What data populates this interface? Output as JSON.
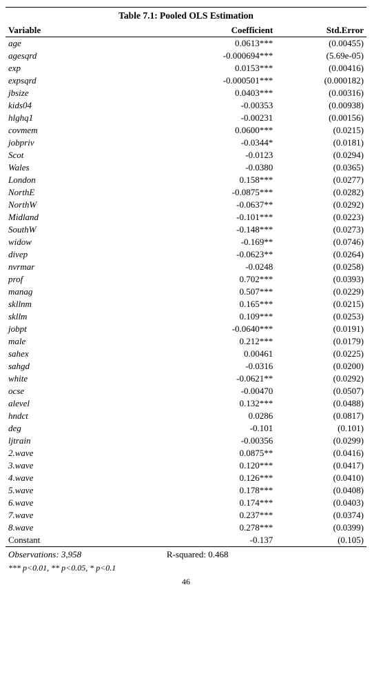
{
  "title": "Table 7.1: Pooled OLS Estimation",
  "headers": [
    "Variable",
    "Coefficient",
    "Std.Error"
  ],
  "rows": [
    [
      "age",
      "0.0613***",
      "(0.00455)"
    ],
    [
      "agesqrd",
      "-0.000694***",
      "(5.69e-05)"
    ],
    [
      "exp",
      "0.0153***",
      "(0.00416)"
    ],
    [
      "expsqrd",
      "-0.000501***",
      "(0.000182)"
    ],
    [
      "jbsize",
      "0.0403***",
      "(0.00316)"
    ],
    [
      "kids04",
      "-0.00353",
      "(0.00938)"
    ],
    [
      "hlghq1",
      "-0.00231",
      "(0.00156)"
    ],
    [
      "covmem",
      "0.0600***",
      "(0.0215)"
    ],
    [
      "jobpriv",
      "-0.0344*",
      "(0.0181)"
    ],
    [
      "Scot",
      "-0.0123",
      "(0.0294)"
    ],
    [
      "Wales",
      "-0.0380",
      "(0.0365)"
    ],
    [
      "London",
      "0.158***",
      "(0.0277)"
    ],
    [
      "NorthE",
      "-0.0875***",
      "(0.0282)"
    ],
    [
      "NorthW",
      "-0.0637**",
      "(0.0292)"
    ],
    [
      "Midland",
      "-0.101***",
      "(0.0223)"
    ],
    [
      "SouthW",
      "-0.148***",
      "(0.0273)"
    ],
    [
      "widow",
      "-0.169**",
      "(0.0746)"
    ],
    [
      "divep",
      "-0.0623**",
      "(0.0264)"
    ],
    [
      "nvrmar",
      "-0.0248",
      "(0.0258)"
    ],
    [
      "prof",
      "0.702***",
      "(0.0393)"
    ],
    [
      "manag",
      "0.507***",
      "(0.0229)"
    ],
    [
      "skllnm",
      "0.165***",
      "(0.0215)"
    ],
    [
      "skllm",
      "0.109***",
      "(0.0253)"
    ],
    [
      "jobpt",
      "-0.0640***",
      "(0.0191)"
    ],
    [
      "male",
      "0.212***",
      "(0.0179)"
    ],
    [
      "sahex",
      "0.00461",
      "(0.0225)"
    ],
    [
      "sahgd",
      "-0.0316",
      "(0.0200)"
    ],
    [
      "white",
      "-0.0621**",
      "(0.0292)"
    ],
    [
      "ocse",
      "-0.00470",
      "(0.0507)"
    ],
    [
      "alevel",
      "0.132***",
      "(0.0488)"
    ],
    [
      "hndct",
      "0.0286",
      "(0.0817)"
    ],
    [
      "deg",
      "-0.101",
      "(0.101)"
    ],
    [
      "ljtrain",
      "-0.00356",
      "(0.0299)"
    ],
    [
      "2.wave",
      "0.0875**",
      "(0.0416)"
    ],
    [
      "3.wave",
      "0.120***",
      "(0.0417)"
    ],
    [
      "4.wave",
      "0.126***",
      "(0.0410)"
    ],
    [
      "5.wave",
      "0.178***",
      "(0.0408)"
    ],
    [
      "6.wave",
      "0.174***",
      "(0.0403)"
    ],
    [
      "7.wave",
      "0.237***",
      "(0.0374)"
    ],
    [
      "8.wave",
      "0.278***",
      "(0.0399)"
    ],
    [
      "Constant",
      "-0.137",
      "(0.105)"
    ]
  ],
  "footer": {
    "observations": "Observations: 3,958",
    "rsquared": "R-squared: 0.468"
  },
  "significance": "*** p<0.01, ** p<0.05, * p<0.1",
  "page_number": "46"
}
